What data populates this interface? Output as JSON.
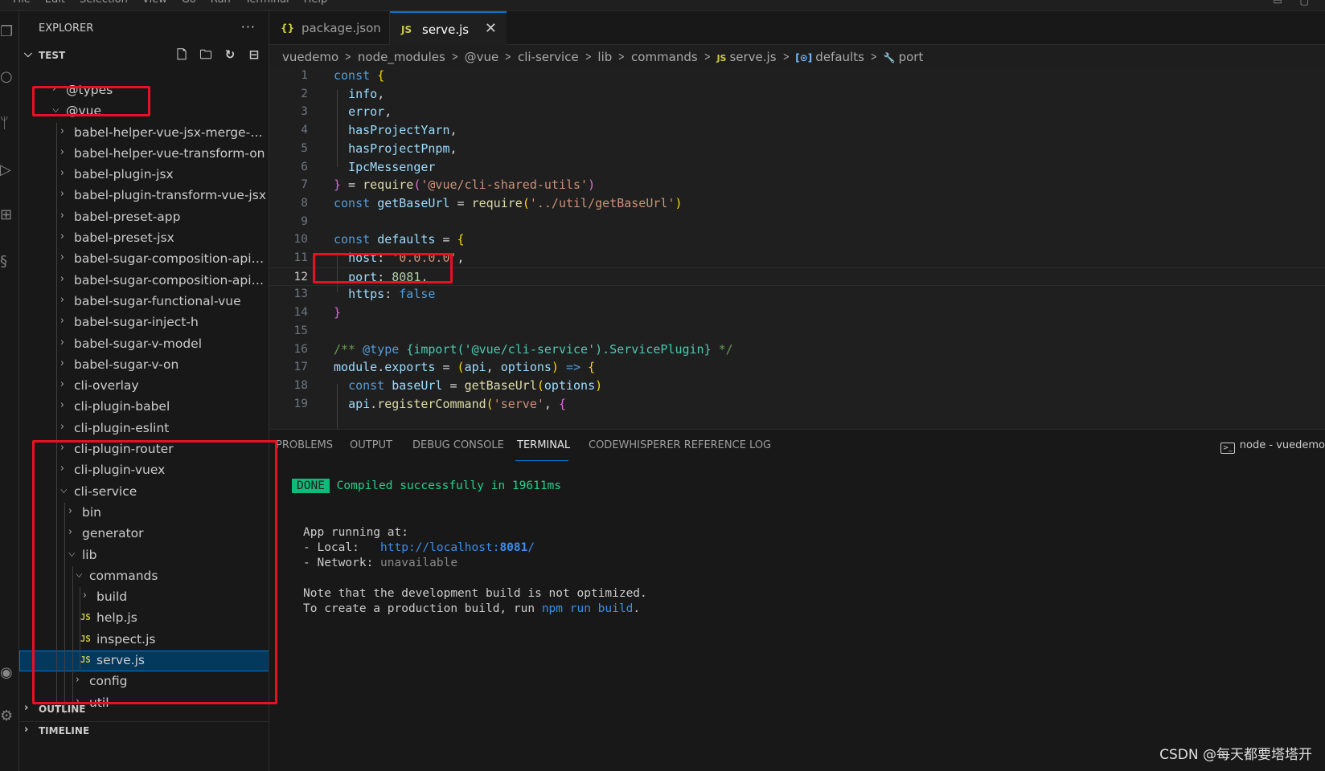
{
  "menubar": {
    "items": [
      "File",
      "Edit",
      "Selection",
      "View",
      "Go",
      "Run",
      "Terminal",
      "Help"
    ],
    "window_buttons": [
      "▭",
      "▢"
    ]
  },
  "explorer": {
    "title": "EXPLORER",
    "more": "···",
    "root": "TEST",
    "outline": "OUTLINE",
    "timeline": "TIMELINE",
    "tree": [
      {
        "label": "@types",
        "depth": 0,
        "type": "folder",
        "open": false
      },
      {
        "label": "@vue",
        "depth": 0,
        "type": "folder",
        "open": true
      },
      {
        "label": "babel-helper-vue-jsx-merge-pr...",
        "depth": 1,
        "type": "folder",
        "open": false
      },
      {
        "label": "babel-helper-vue-transform-on",
        "depth": 1,
        "type": "folder",
        "open": false
      },
      {
        "label": "babel-plugin-jsx",
        "depth": 1,
        "type": "folder",
        "open": false
      },
      {
        "label": "babel-plugin-transform-vue-jsx",
        "depth": 1,
        "type": "folder",
        "open": false
      },
      {
        "label": "babel-preset-app",
        "depth": 1,
        "type": "folder",
        "open": false
      },
      {
        "label": "babel-preset-jsx",
        "depth": 1,
        "type": "folder",
        "open": false
      },
      {
        "label": "babel-sugar-composition-api-i...",
        "depth": 1,
        "type": "folder",
        "open": false
      },
      {
        "label": "babel-sugar-composition-api-r...",
        "depth": 1,
        "type": "folder",
        "open": false
      },
      {
        "label": "babel-sugar-functional-vue",
        "depth": 1,
        "type": "folder",
        "open": false
      },
      {
        "label": "babel-sugar-inject-h",
        "depth": 1,
        "type": "folder",
        "open": false
      },
      {
        "label": "babel-sugar-v-model",
        "depth": 1,
        "type": "folder",
        "open": false
      },
      {
        "label": "babel-sugar-v-on",
        "depth": 1,
        "type": "folder",
        "open": false
      },
      {
        "label": "cli-overlay",
        "depth": 1,
        "type": "folder",
        "open": false
      },
      {
        "label": "cli-plugin-babel",
        "depth": 1,
        "type": "folder",
        "open": false
      },
      {
        "label": "cli-plugin-eslint",
        "depth": 1,
        "type": "folder",
        "open": false
      },
      {
        "label": "cli-plugin-router",
        "depth": 1,
        "type": "folder",
        "open": false
      },
      {
        "label": "cli-plugin-vuex",
        "depth": 1,
        "type": "folder",
        "open": false
      },
      {
        "label": "cli-service",
        "depth": 1,
        "type": "folder",
        "open": true
      },
      {
        "label": "bin",
        "depth": 2,
        "type": "folder",
        "open": false
      },
      {
        "label": "generator",
        "depth": 2,
        "type": "folder",
        "open": false
      },
      {
        "label": "lib",
        "depth": 2,
        "type": "folder",
        "open": true
      },
      {
        "label": "commands",
        "depth": 3,
        "type": "folder",
        "open": true
      },
      {
        "label": "build",
        "depth": 4,
        "type": "folder",
        "open": false
      },
      {
        "label": "help.js",
        "depth": 4,
        "type": "js",
        "open": false
      },
      {
        "label": "inspect.js",
        "depth": 4,
        "type": "js",
        "open": false
      },
      {
        "label": "serve.js",
        "depth": 4,
        "type": "js",
        "open": false,
        "selected": true
      },
      {
        "label": "config",
        "depth": 3,
        "type": "folder",
        "open": false
      },
      {
        "label": "util",
        "depth": 3,
        "type": "folder",
        "open": false
      }
    ]
  },
  "tabs": [
    {
      "icon": "{}",
      "label": "package.json",
      "active": false
    },
    {
      "icon": "JS",
      "label": "serve.js",
      "active": true,
      "close": "✕"
    }
  ],
  "breadcrumbs": [
    "vuedemo",
    "node_modules",
    "@vue",
    "cli-service",
    "lib",
    "commands",
    "serve.js",
    "defaults",
    "port"
  ],
  "breadcrumb_icons": {
    "js": "JS",
    "symbol": "[⊙]",
    "wrench": "🔧"
  },
  "editor": {
    "current_line": 12,
    "lines": [
      {
        "n": "1",
        "text": "const {"
      },
      {
        "n": "2",
        "text": "  info,"
      },
      {
        "n": "3",
        "text": "  error,"
      },
      {
        "n": "4",
        "text": "  hasProjectYarn,"
      },
      {
        "n": "5",
        "text": "  hasProjectPnpm,"
      },
      {
        "n": "6",
        "text": "  IpcMessenger"
      },
      {
        "n": "7",
        "text": "} = require('@vue/cli-shared-utils')"
      },
      {
        "n": "8",
        "text": "const getBaseUrl = require('../util/getBaseUrl')"
      },
      {
        "n": "9",
        "text": ""
      },
      {
        "n": "10",
        "text": "const defaults = {"
      },
      {
        "n": "11",
        "text": "  host: '0.0.0.0',"
      },
      {
        "n": "12",
        "text": "  port: 8081,"
      },
      {
        "n": "13",
        "text": "  https: false"
      },
      {
        "n": "14",
        "text": "}"
      },
      {
        "n": "15",
        "text": ""
      },
      {
        "n": "16",
        "text": "/** @type {import('@vue/cli-service').ServicePlugin} */"
      },
      {
        "n": "17",
        "text": "module.exports = (api, options) => {"
      },
      {
        "n": "18",
        "text": "  const baseUrl = getBaseUrl(options)"
      },
      {
        "n": "19",
        "text": "  api.registerCommand('serve', {"
      }
    ]
  },
  "panel": {
    "tabs": [
      "PROBLEMS",
      "OUTPUT",
      "DEBUG CONSOLE",
      "TERMINAL",
      "CODEWHISPERER REFERENCE LOG"
    ],
    "active_tab": "TERMINAL",
    "terminal_name": "node - vuedemo",
    "terminal_icon": ">_",
    "terminal": {
      "done_badge": "DONE",
      "compiled": "Compiled successfully in 19611ms",
      "app_running": "App running at:",
      "local_label": "- Local:   ",
      "local_url_prefix": "http://localhost:",
      "local_url_port": "8081",
      "local_url_suffix": "/",
      "network_label": "- Network: ",
      "network_value": "unavailable",
      "note": "Note that the development build is not optimized.",
      "create_prefix": "To create a production build, run ",
      "create_cmd": "npm run build",
      "create_suffix": "."
    }
  },
  "watermark": "CSDN @每天都要塔塔开",
  "colors": {
    "annotation_red": "#e81123",
    "accent": "#0078d4",
    "done_green": "#0dbc79"
  }
}
